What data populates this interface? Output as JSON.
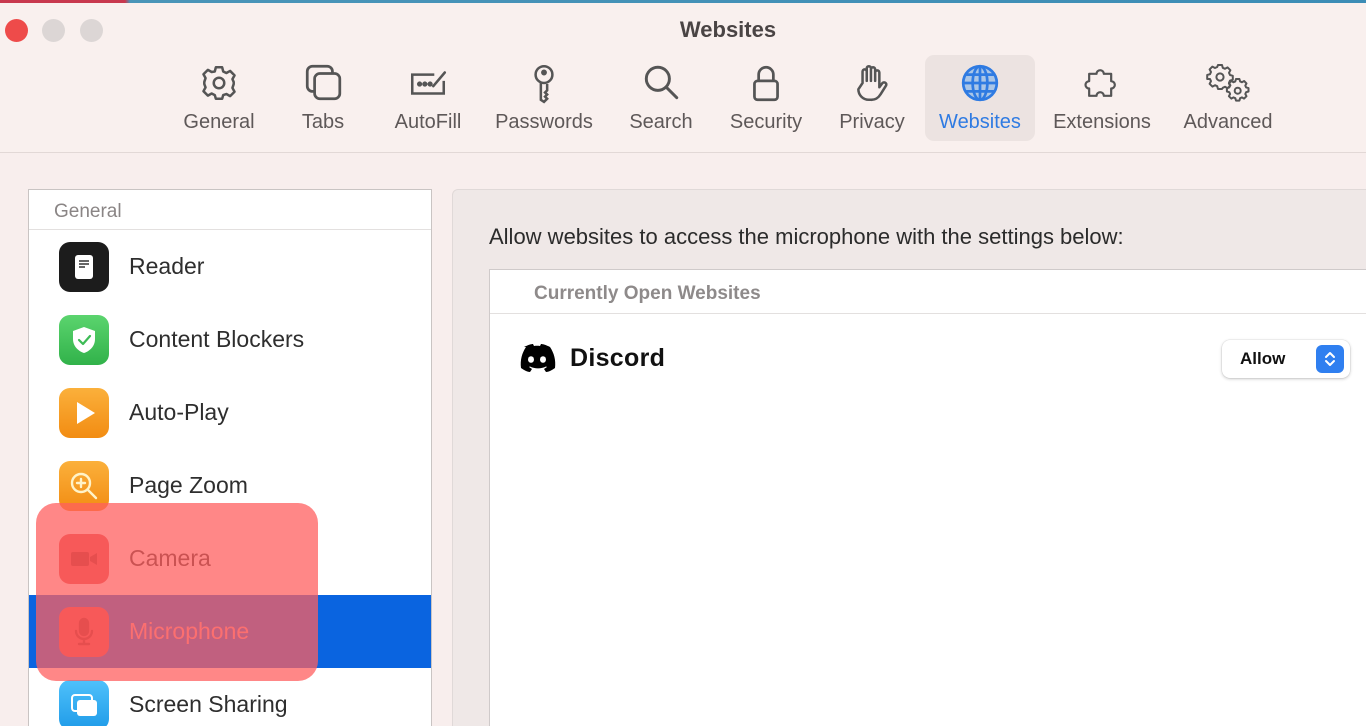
{
  "window": {
    "title": "Websites"
  },
  "toolbar": {
    "items": [
      {
        "label": "General",
        "icon": "gear-icon"
      },
      {
        "label": "Tabs",
        "icon": "tabs-icon"
      },
      {
        "label": "AutoFill",
        "icon": "autofill-icon"
      },
      {
        "label": "Passwords",
        "icon": "key-icon"
      },
      {
        "label": "Search",
        "icon": "search-icon"
      },
      {
        "label": "Security",
        "icon": "lock-icon"
      },
      {
        "label": "Privacy",
        "icon": "hand-icon"
      },
      {
        "label": "Websites",
        "icon": "globe-icon",
        "active": true
      },
      {
        "label": "Extensions",
        "icon": "puzzle-icon"
      },
      {
        "label": "Advanced",
        "icon": "gears-icon"
      }
    ],
    "active_color": "#2f7be2"
  },
  "sidebar": {
    "section_header": "General",
    "items": [
      {
        "label": "Reader",
        "icon": "reader-icon",
        "color": "#1c1c1c"
      },
      {
        "label": "Content Blockers",
        "icon": "shield-check-icon",
        "color": "#3dbb56"
      },
      {
        "label": "Auto-Play",
        "icon": "play-icon",
        "color": "#f59a1b"
      },
      {
        "label": "Page Zoom",
        "icon": "zoom-in-icon",
        "color": "#f59a1b"
      },
      {
        "label": "Camera",
        "icon": "video-camera-icon",
        "color": "#e04a4a"
      },
      {
        "label": "Microphone",
        "icon": "microphone-icon",
        "color": "#e04a4a",
        "selected": true
      },
      {
        "label": "Screen Sharing",
        "icon": "screen-sharing-icon",
        "color": "#2ba8f0"
      }
    ],
    "selected_color": "#0a64e0"
  },
  "content": {
    "description": "Allow websites to access the microphone with the settings below:",
    "table_header": "Currently Open Websites",
    "sites": [
      {
        "name": "Discord",
        "permission": "Allow"
      }
    ]
  }
}
